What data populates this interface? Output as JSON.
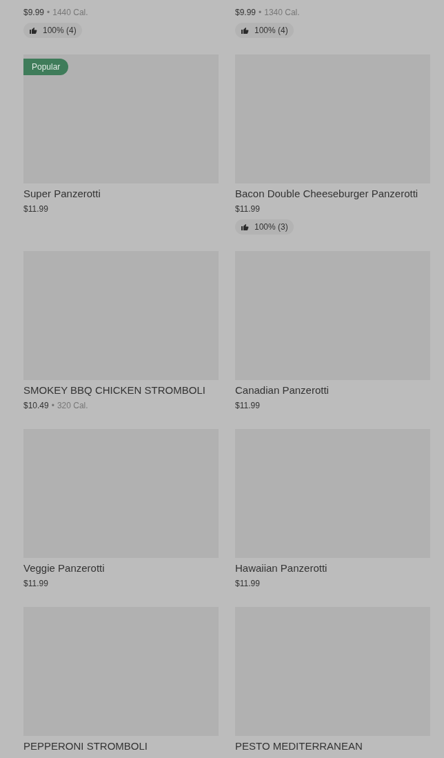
{
  "items": [
    {
      "price": "$9.99",
      "separator": "•",
      "calories": "1440 Cal.",
      "rating": "100% (4)",
      "partial": true
    },
    {
      "price": "$9.99",
      "separator": "•",
      "calories": "1340 Cal.",
      "rating": "100% (4)",
      "partial": true
    },
    {
      "title": "Super Panzerotti",
      "price": "$11.99",
      "badge": "Popular"
    },
    {
      "title": "Bacon Double Cheeseburger Panzerotti",
      "price": "$11.99",
      "rating": "100% (3)"
    },
    {
      "title": "SMOKEY BBQ CHICKEN STROMBOLI",
      "price": "$10.49",
      "separator": "•",
      "calories": "320 Cal."
    },
    {
      "title": "Canadian Panzerotti",
      "price": "$11.99"
    },
    {
      "title": "Veggie Panzerotti",
      "price": "$11.99"
    },
    {
      "title": "Hawaiian Panzerotti",
      "price": "$11.99"
    },
    {
      "title": "PEPPERONI STROMBOLI"
    },
    {
      "title": "PESTO MEDITERRANEAN"
    }
  ]
}
